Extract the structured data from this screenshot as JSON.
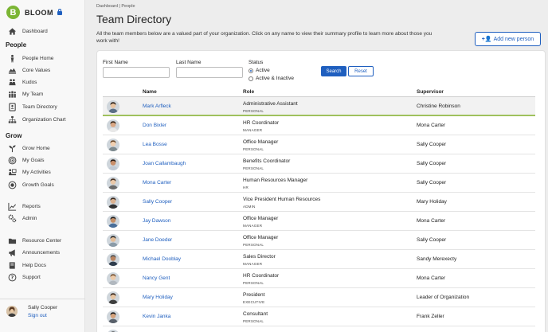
{
  "brand": {
    "name": "BLOOM",
    "logo_letter": "B",
    "accent": "#7bb534",
    "link_color": "#1f5fbf"
  },
  "sidebar": {
    "dashboard": {
      "label": "Dashboard",
      "icon": "home-icon"
    },
    "sections": [
      {
        "title": "People",
        "items": [
          {
            "label": "People Home",
            "icon": "person-icon"
          },
          {
            "label": "Core Values",
            "icon": "values-icon"
          },
          {
            "label": "Kudos",
            "icon": "kudos-icon"
          },
          {
            "label": "My Team",
            "icon": "team-icon"
          },
          {
            "label": "Team Directory",
            "icon": "directory-icon"
          },
          {
            "label": "Organization Chart",
            "icon": "org-chart-icon"
          }
        ]
      },
      {
        "title": "Grow",
        "items": [
          {
            "label": "Grow Home",
            "icon": "sprout-icon"
          },
          {
            "label": "My Goals",
            "icon": "target-icon"
          },
          {
            "label": "My Activities",
            "icon": "activities-icon"
          },
          {
            "label": "Growth Goals",
            "icon": "growth-target-icon"
          }
        ]
      },
      {
        "title": "",
        "items": [
          {
            "label": "Reports",
            "icon": "reports-icon"
          },
          {
            "label": "Admin",
            "icon": "gears-icon"
          }
        ]
      },
      {
        "title": "",
        "items": [
          {
            "label": "Resource Center",
            "icon": "folder-icon"
          },
          {
            "label": "Announcements",
            "icon": "megaphone-icon"
          },
          {
            "label": "Help Docs",
            "icon": "book-icon"
          },
          {
            "label": "Support",
            "icon": "help-icon"
          }
        ]
      }
    ],
    "user": {
      "name": "Sally Cooper",
      "signout": "Sign out"
    }
  },
  "main": {
    "breadcrumb": "Dashboard | People",
    "title": "Team Directory",
    "description": "All the team members below are a valued part of your organization. Click on any name to view their summary profile to learn more about those you work with!",
    "add_button": "Add new person",
    "filters": {
      "first_name_label": "First Name",
      "last_name_label": "Last Name",
      "status_label": "Status",
      "status_options": [
        "Active",
        "Active & Inactive"
      ],
      "status_selected": "Active",
      "search_label": "Search",
      "reset_label": "Reset"
    },
    "table": {
      "headers": [
        "Name",
        "Role",
        "Supervisor"
      ],
      "rows": [
        {
          "name": "Mark Arfleck",
          "role": "Administrative Assistant",
          "level": "PERSONAL",
          "supervisor": "Christine Robinson"
        },
        {
          "name": "Don Bixler",
          "role": "HR Coordinator",
          "level": "MANAGER",
          "supervisor": "Mona Carter"
        },
        {
          "name": "Lea Bosse",
          "role": "Office Manager",
          "level": "PERSONAL",
          "supervisor": "Sally Cooper"
        },
        {
          "name": "Joan Callambaugh",
          "role": "Benefits Coordinator",
          "level": "PERSONAL",
          "supervisor": "Sally Cooper"
        },
        {
          "name": "Mona Carter",
          "role": "Human Resources Manager",
          "level": "HR",
          "supervisor": "Sally Cooper"
        },
        {
          "name": "Sally Cooper",
          "role": "Vice President Human Resources",
          "level": "ADMIN",
          "supervisor": "Mary Holiday"
        },
        {
          "name": "Jay Dawson",
          "role": "Office Manager",
          "level": "MANAGER",
          "supervisor": "Mona Carter"
        },
        {
          "name": "Jane Doeder",
          "role": "Office Manager",
          "level": "PERSONAL",
          "supervisor": "Sally Cooper"
        },
        {
          "name": "Michael Dooblay",
          "role": "Sales Director",
          "level": "MANAGER",
          "supervisor": "Sandy Merexecty"
        },
        {
          "name": "Nancy Gent",
          "role": "HR Coordinator",
          "level": "PERSONAL",
          "supervisor": "Mona Carter"
        },
        {
          "name": "Mary Holiday",
          "role": "President",
          "level": "EXECUTIVE",
          "supervisor": "Leader of Organization"
        },
        {
          "name": "Kevin Janka",
          "role": "Consultant",
          "level": "PERSONAL",
          "supervisor": "Frank Zeller"
        },
        {
          "name": "",
          "role": "",
          "level": "",
          "supervisor": ""
        }
      ]
    }
  }
}
